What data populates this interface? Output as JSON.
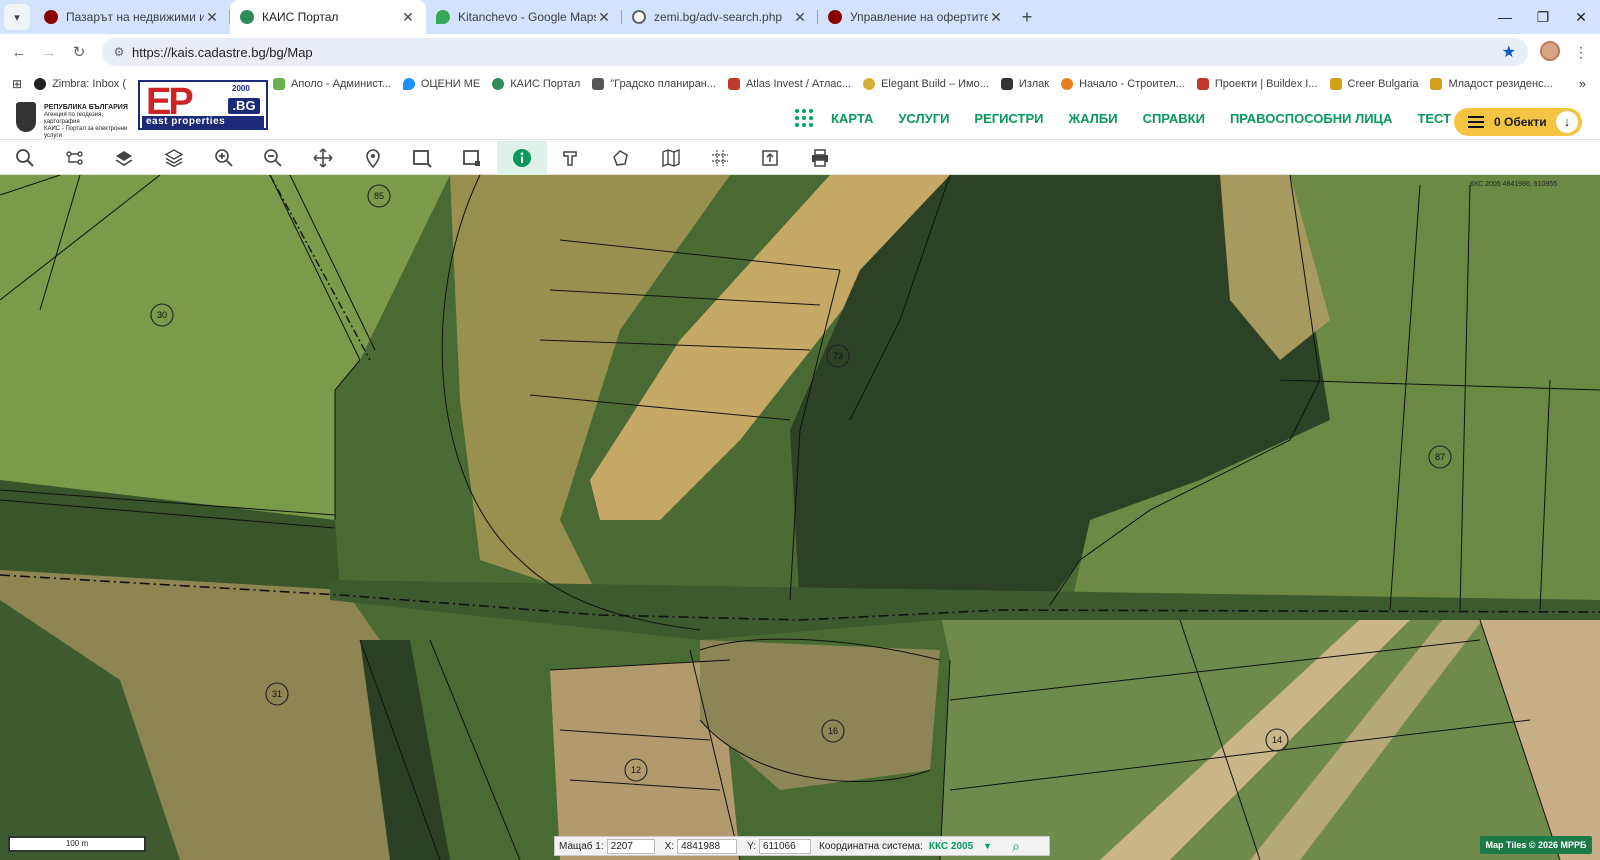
{
  "browser": {
    "tabs": [
      {
        "title": "Пазарът на недвижими имоти",
        "favicon_color": "#8b0000",
        "active": false
      },
      {
        "title": "КАИС Портал",
        "favicon_color": "#2e8b57",
        "active": true
      },
      {
        "title": "Kitanchevo - Google Maps",
        "favicon_color": "#34a853",
        "active": false
      },
      {
        "title": "zemi.bg/adv-search.php",
        "favicon_color": "#5f6368",
        "active": false
      },
      {
        "title": "Управление на офертите -",
        "favicon_color": "#8b0000",
        "active": false
      }
    ],
    "url": "https://kais.cadastre.bg/bg/Map",
    "bookmarks": [
      {
        "label": "Zimbra: Inbox (",
        "color": "#222"
      },
      {
        "label": "Аполо - Админист...",
        "color": "#6ab04c"
      },
      {
        "label": "ОЦЕНИ МЕ",
        "color": "#1e90ff"
      },
      {
        "label": "КАИС Портал",
        "color": "#2e8b57"
      },
      {
        "label": "\"Градско планиран...",
        "color": "#555"
      },
      {
        "label": "Atlas Invest / Атлас...",
        "color": "#c0392b"
      },
      {
        "label": "Elegant Build – Имо...",
        "color": "#d4af37"
      },
      {
        "label": "Излак",
        "color": "#333"
      },
      {
        "label": "Начало - Строител...",
        "color": "#e67e22"
      },
      {
        "label": "Проекти | Buildex I...",
        "color": "#c0392b"
      },
      {
        "label": "Creer Bulgaria",
        "color": "#d4a017"
      },
      {
        "label": "Младост резиденс...",
        "color": "#d4a017"
      }
    ]
  },
  "header": {
    "agency_title": "РЕПУБЛИКА БЪЛГАРИЯ",
    "agency_line1": "Агенция по геодезия, картография",
    "agency_line2": "КАИС - Портал за електронни услуги",
    "logo_ep": "EP",
    "logo_bg": ".BG",
    "logo_year": "2000",
    "logo_band": "east properties",
    "nav": [
      "КАРТА",
      "УСЛУГИ",
      "РЕГИСТРИ",
      "ЖАЛБИ",
      "СПРАВКИ",
      "ПРАВОСПОСОБНИ ЛИЦА",
      "ТЕСТ"
    ],
    "objects_button": "0 Обекти"
  },
  "toolbar": [
    "search-icon",
    "layers-tree-icon",
    "layers-icon",
    "stack-icon",
    "zoom-in-icon",
    "zoom-out-icon",
    "pan-icon",
    "pin-icon",
    "select-rect-icon",
    "select-area-icon",
    "info-icon",
    "measure-icon",
    "polygon-icon",
    "map-icon",
    "grid-icon",
    "export-icon",
    "print-icon"
  ],
  "map": {
    "coord_label": "ККС 2005 4841986, 610955",
    "parcel_labels": [
      "85",
      "30",
      "73",
      "87",
      "31",
      "16",
      "12",
      "14"
    ],
    "scale_label": "100 m",
    "status": {
      "scale_label": "Мащаб 1:",
      "scale_value": "2207",
      "x_label": "X:",
      "x_value": "4841988",
      "y_label": "Y:",
      "y_value": "611066",
      "cs_label": "Координатна система:",
      "cs_value": "ККС 2005"
    },
    "credit": "Map Tiles © 2026 МРРБ"
  }
}
